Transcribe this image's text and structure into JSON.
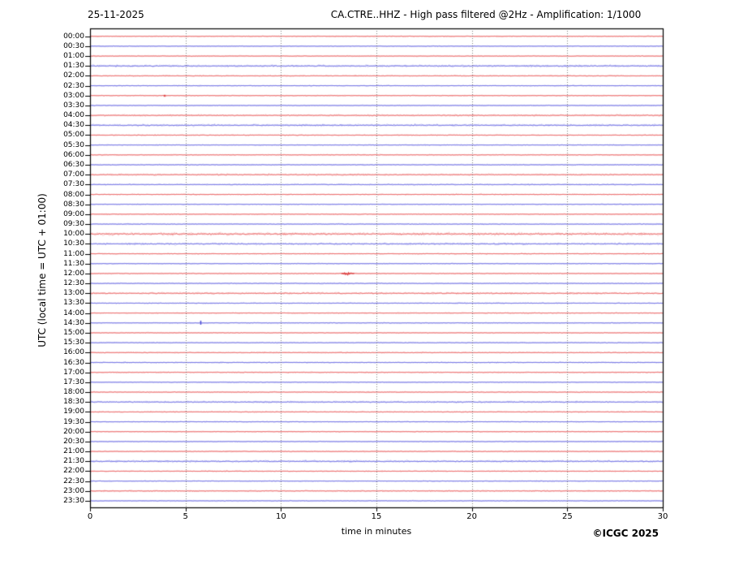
{
  "figure": {
    "date": "25-11-2025",
    "title": "CA.CTRE..HHZ - High pass filtered @2Hz - Amplification: 1/1000",
    "copyright": "©ICGC 2025"
  },
  "chart_data": {
    "type": "line",
    "subtype": "helicorder-dayplot",
    "station": "CA.CTRE..HHZ",
    "filter": "High pass filtered @2Hz",
    "amplification": "1/1000",
    "xlabel": "time in minutes",
    "ylabel": "UTC (local time = UTC + 01:00)",
    "x_range": [
      0,
      30
    ],
    "x_ticks": [
      0,
      5,
      10,
      15,
      20,
      25,
      30
    ],
    "minutes_per_row": 30,
    "grid": "vertical dotted gray lines every 5 minutes",
    "legend_position": "none",
    "colors": {
      "hour_trace": "#e85050",
      "half_hour_trace": "#5a5ae0",
      "event_red": "#d83030",
      "event_blue": "#4040d0",
      "grid": "#606060",
      "frame": "#000000",
      "background": "#ffffff"
    },
    "rows": [
      {
        "label": "00:00",
        "color": "red",
        "amp": 0.7
      },
      {
        "label": "00:30",
        "color": "blue",
        "amp": 0.7
      },
      {
        "label": "01:00",
        "color": "red",
        "amp": 0.7
      },
      {
        "label": "01:30",
        "color": "blue",
        "amp": 1.3
      },
      {
        "label": "02:00",
        "color": "red",
        "amp": 0.8
      },
      {
        "label": "02:30",
        "color": "blue",
        "amp": 0.7
      },
      {
        "label": "03:00",
        "color": "red",
        "amp": 0.7
      },
      {
        "label": "03:30",
        "color": "blue",
        "amp": 0.7
      },
      {
        "label": "04:00",
        "color": "red",
        "amp": 1.1
      },
      {
        "label": "04:30",
        "color": "blue",
        "amp": 1.3
      },
      {
        "label": "05:00",
        "color": "red",
        "amp": 0.8
      },
      {
        "label": "05:30",
        "color": "blue",
        "amp": 0.7
      },
      {
        "label": "06:00",
        "color": "red",
        "amp": 0.8
      },
      {
        "label": "06:30",
        "color": "blue",
        "amp": 0.8
      },
      {
        "label": "07:00",
        "color": "red",
        "amp": 1.1
      },
      {
        "label": "07:30",
        "color": "blue",
        "amp": 0.9
      },
      {
        "label": "08:00",
        "color": "red",
        "amp": 0.8
      },
      {
        "label": "08:30",
        "color": "blue",
        "amp": 0.7
      },
      {
        "label": "09:00",
        "color": "red",
        "amp": 0.8
      },
      {
        "label": "09:30",
        "color": "blue",
        "amp": 0.8
      },
      {
        "label": "10:00",
        "color": "red",
        "amp": 1.7
      },
      {
        "label": "10:30",
        "color": "blue",
        "amp": 1.3
      },
      {
        "label": "11:00",
        "color": "red",
        "amp": 0.8
      },
      {
        "label": "11:30",
        "color": "blue",
        "amp": 0.7
      },
      {
        "label": "12:00",
        "color": "red",
        "amp": 0.8
      },
      {
        "label": "12:30",
        "color": "blue",
        "amp": 0.8
      },
      {
        "label": "13:00",
        "color": "red",
        "amp": 1.2
      },
      {
        "label": "13:30",
        "color": "blue",
        "amp": 0.8
      },
      {
        "label": "14:00",
        "color": "red",
        "amp": 0.7
      },
      {
        "label": "14:30",
        "color": "blue",
        "amp": 0.7
      },
      {
        "label": "15:00",
        "color": "red",
        "amp": 0.7
      },
      {
        "label": "15:30",
        "color": "blue",
        "amp": 0.8
      },
      {
        "label": "16:00",
        "color": "red",
        "amp": 0.8
      },
      {
        "label": "16:30",
        "color": "blue",
        "amp": 0.8
      },
      {
        "label": "17:00",
        "color": "red",
        "amp": 0.8
      },
      {
        "label": "17:30",
        "color": "blue",
        "amp": 0.7
      },
      {
        "label": "18:00",
        "color": "red",
        "amp": 0.8
      },
      {
        "label": "18:30",
        "color": "blue",
        "amp": 1.1
      },
      {
        "label": "19:00",
        "color": "red",
        "amp": 0.8
      },
      {
        "label": "19:30",
        "color": "blue",
        "amp": 0.7
      },
      {
        "label": "20:00",
        "color": "red",
        "amp": 0.7
      },
      {
        "label": "20:30",
        "color": "blue",
        "amp": 0.7
      },
      {
        "label": "21:00",
        "color": "red",
        "amp": 0.8
      },
      {
        "label": "21:30",
        "color": "blue",
        "amp": 1.3
      },
      {
        "label": "22:00",
        "color": "red",
        "amp": 0.8
      },
      {
        "label": "22:30",
        "color": "blue",
        "amp": 0.7
      },
      {
        "label": "23:00",
        "color": "red",
        "amp": 0.9
      },
      {
        "label": "23:30",
        "color": "blue",
        "amp": 0.7
      }
    ],
    "events": [
      {
        "row": "03:00",
        "minute": 3.9,
        "kind": "minor-dot",
        "color": "red"
      },
      {
        "row": "12:00",
        "minute": 13.5,
        "kind": "small-burst",
        "color": "red"
      },
      {
        "row": "14:30",
        "minute": 5.8,
        "kind": "spike",
        "color": "blue"
      }
    ]
  }
}
